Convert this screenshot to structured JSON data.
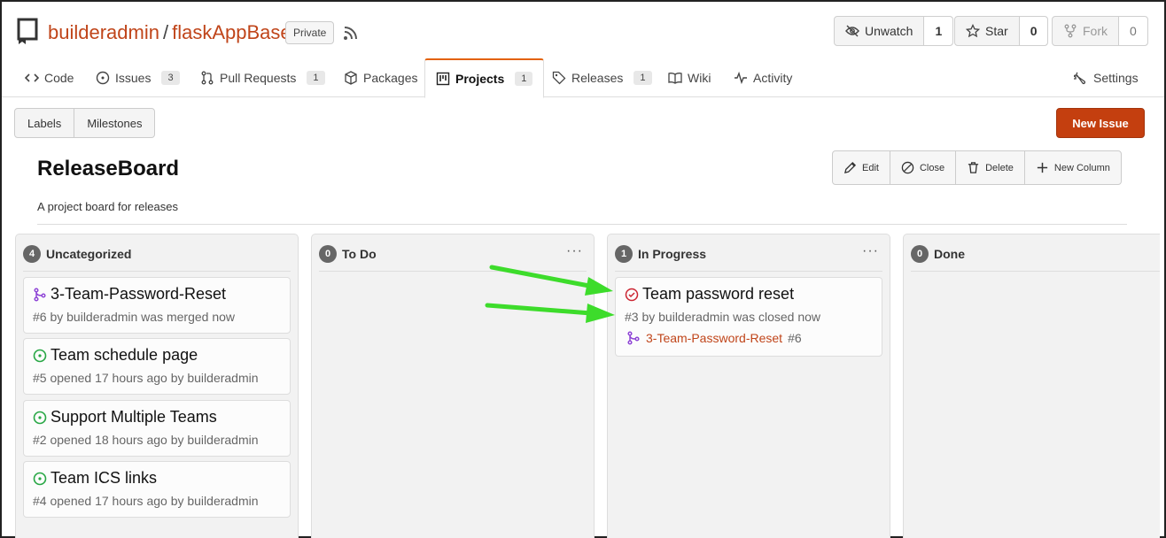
{
  "repo": {
    "owner": "builderadmin",
    "separator": "/",
    "name": "flaskAppBase",
    "visibility": "Private"
  },
  "header_buttons": {
    "watch": {
      "label": "Unwatch",
      "count": "1"
    },
    "star": {
      "label": "Star",
      "count": "0"
    },
    "fork": {
      "label": "Fork",
      "count": "0"
    }
  },
  "tabs": [
    {
      "label": "Code",
      "icon": "code-icon"
    },
    {
      "label": "Issues",
      "count": "3",
      "icon": "issue-icon"
    },
    {
      "label": "Pull Requests",
      "count": "1",
      "icon": "pull-request-icon"
    },
    {
      "label": "Packages",
      "icon": "package-icon"
    },
    {
      "label": "Projects",
      "count": "1",
      "icon": "project-icon",
      "active": true
    },
    {
      "label": "Releases",
      "count": "1",
      "icon": "tag-icon"
    },
    {
      "label": "Wiki",
      "icon": "book-icon"
    },
    {
      "label": "Activity",
      "icon": "pulse-icon"
    },
    {
      "label": "Settings",
      "icon": "tools-icon"
    }
  ],
  "subnav": {
    "labels": "Labels",
    "milestones": "Milestones"
  },
  "new_issue": "New Issue",
  "board": {
    "title": "ReleaseBoard",
    "description": "A project board for releases",
    "actions": {
      "edit": "Edit",
      "close": "Close",
      "delete": "Delete",
      "new_column": "New Column"
    }
  },
  "columns": [
    {
      "name": "Uncategorized",
      "count": "4",
      "cards": [
        {
          "title": "3-Team-Password-Reset",
          "meta": "#6 by builderadmin was merged now",
          "icon": "merged-icon"
        },
        {
          "title": "Team schedule page",
          "meta": "#5 opened 17 hours ago by builderadmin",
          "icon": "issue-open-icon"
        },
        {
          "title": "Support Multiple Teams",
          "meta": "#2 opened 18 hours ago by builderadmin",
          "icon": "issue-open-icon"
        },
        {
          "title": "Team ICS links",
          "meta": "#4 opened 17 hours ago by builderadmin",
          "icon": "issue-open-icon"
        }
      ]
    },
    {
      "name": "To Do",
      "count": "0",
      "menu": "···",
      "cards": []
    },
    {
      "name": "In Progress",
      "count": "1",
      "menu": "···",
      "cards": [
        {
          "title": "Team password reset",
          "meta": "#3 by builderadmin was closed now",
          "icon": "issue-closed-icon",
          "linked": {
            "name": "3-Team-Password-Reset",
            "number": "#6",
            "icon": "merged-icon"
          }
        }
      ]
    },
    {
      "name": "Done",
      "count": "0",
      "cards": []
    }
  ],
  "colors": {
    "accent": "#c0451a",
    "new_issue_bg": "#c43f0f",
    "open_issue": "#28a745",
    "closed_issue": "#cb2431",
    "merged": "#8e44d6",
    "arrow": "#3ddc2b"
  }
}
